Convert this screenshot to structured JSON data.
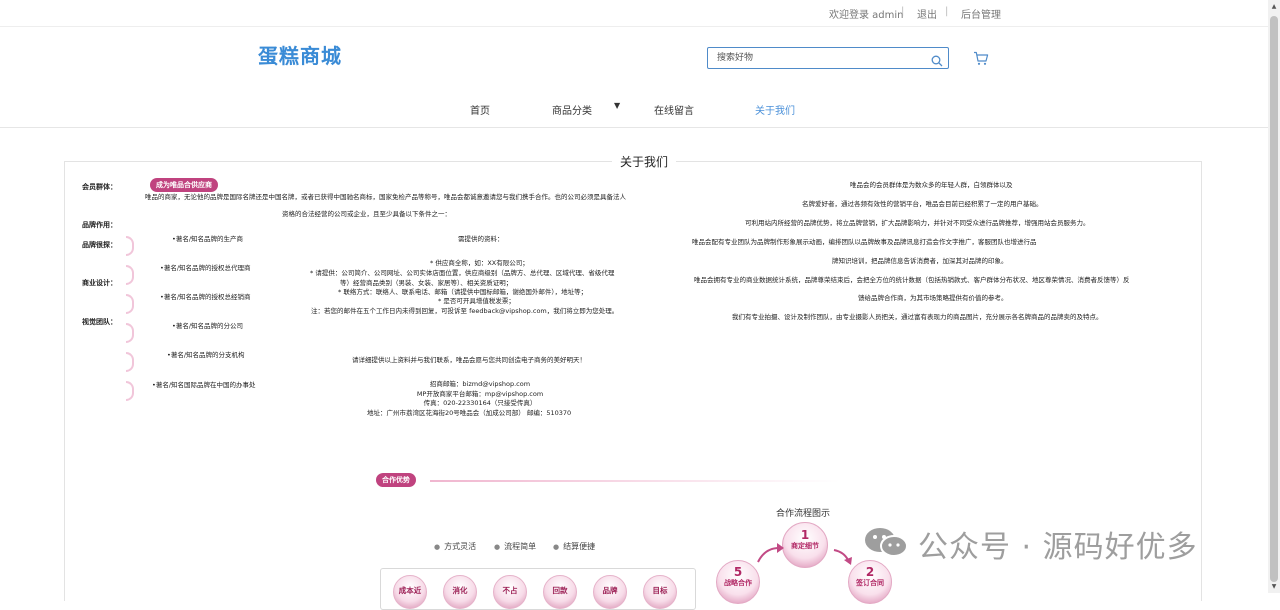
{
  "topbar": {
    "welcome": "欢迎登录 admin",
    "sep1": "|",
    "logout": "退出",
    "sep2": "|",
    "admin": "后台管理"
  },
  "header": {
    "logo": "蛋糕商城",
    "search_placeholder": "搜索好物",
    "search_icon": "search-icon",
    "cart_icon": "cart-icon"
  },
  "nav": {
    "items": [
      "首页",
      "商品分类",
      "在线留言",
      "关于我们"
    ],
    "active_color": "#4a90d9"
  },
  "about": {
    "title": "关于我们",
    "left_labels": [
      "会员群体：",
      "品牌作用：",
      "品牌很探：",
      "商业设计：",
      "视觉团队："
    ],
    "pill_supplier": "成为唯品合供应商",
    "intro1": "唯品的商家，无论他的品牌是国际名牌还是中国名牌，或者已获得中国驰名商标，国家免检产品等称号，唯品会都诚意邀请您与我们携手合作。也的公司必须是具备法人",
    "intro2": "资格的合法经营的公司或企业，且至少具备以下条件之一：",
    "conditions": [
      "•著名/知名品牌的生产商",
      "•著名/知名品牌的授权总代理商",
      "•著名/知名品牌的授权总经销商",
      "•著名/知名品牌的分公司",
      "•著名/知名品牌的分支机构",
      "•著名/知名国际品牌在中国的办事处"
    ],
    "materials_title": "需提供的资料：",
    "materials": [
      "* 供应商全称，如：XX有限公司；",
      "* 请提供：公司简介、公司网址、公司实体店面位置，供应商级别（品牌方、总代理、区域代理、省级代理",
      "等）经营商品类别（男装、女装、家居等）、相关资质证明；",
      "* 联络方式：联络人、联系电话、邮箱（请提供中国标邮箱，谢绝国外邮件），地址等；",
      "* 是否可开具增值税发票；",
      "注：若您的邮件在五个工作日内未得到回复，可投诉至 feedback@vipshop.com，我们将立即为您处理。"
    ],
    "cta": "请详细提供以上资料并与我们联系，唯品会愿与您共同创造电子商务的美好明天！",
    "contacts": [
      "招商邮箱：bizmd@vipshop.com",
      "MP开放商家平台邮箱：mp@vipshop.com",
      "传真：020-22330164（只接受传真）",
      "地址：广州市荔湾区花海街20号唯品会（加成公司部） 邮编：510370"
    ],
    "right_paras": [
      "唯品会的会员群体是为数众多的年轻人群，白领群体以及",
      "名牌爱好者，通过各频有效性的营销平台，唯品会目前已经积累了一定的用户基础。",
      "可利用站内所经营的品牌优势，将立品牌营销，扩大品牌影响力，并针对不同受众进行品牌推荐，增强用站会员服务力。",
      "唯品会配有专业团队为品牌制作形象展示动画，编排团队以品牌故事及品牌讯息打造会作文字推广，客服团队也增进行品",
      "牌知识培训，把品牌信息告诉消费者，加深其对品牌的印象。",
      "唯品会拥有专业的商业数据统计系统，品牌尊荣结束后，会把全方位的统计数据（包括热销款式、客户群体分布状况、地区尊荣情况、消费者反馈等）反",
      "馈给品牌合作商，为其市场策略提供有价值的参考。",
      "我们有专业拍摄、设计及制作团队，由专业摄影人员把关，通过富有表现力的商品图片，充分展示各名牌商品的品牌卖的及特点。"
    ]
  },
  "partner": {
    "pill": "合作优势",
    "benefits": [
      "方式灵活",
      "流程简单",
      "结算便捷"
    ],
    "circles": [
      "成本近",
      "消化",
      "不占",
      "回款",
      "品牌",
      "目标"
    ],
    "flow_title": "合作流程图示",
    "steps": [
      {
        "num": "1",
        "label": "商定细节"
      },
      {
        "num": "2",
        "label": "签订合同"
      },
      {
        "num": "5",
        "label": "战略合作"
      }
    ]
  },
  "watermark": "公众号 · 源码好优多"
}
